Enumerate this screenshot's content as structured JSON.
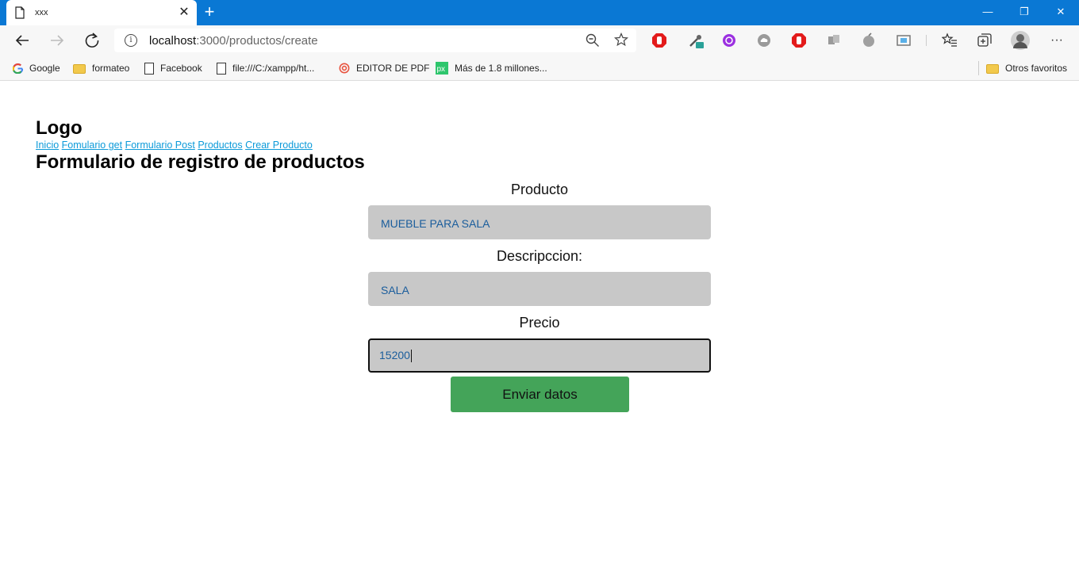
{
  "browser": {
    "tab": {
      "title": "xxx",
      "close": "✕"
    },
    "new_tab": "+",
    "window": {
      "minimize": "—",
      "restore": "❐",
      "close": "✕"
    },
    "address": {
      "host": "localhost",
      "path": ":3000/productos/create"
    },
    "more": "···",
    "bookmarks": [
      {
        "label": "Google",
        "icon": "google-icon"
      },
      {
        "label": "formateo",
        "icon": "folder-icon"
      },
      {
        "label": "Facebook",
        "icon": "page-icon"
      },
      {
        "label": "file:///C:/xampp/ht...",
        "icon": "page-icon"
      },
      {
        "label": "EDITOR DE PDF",
        "icon": "pdf-editor-icon"
      },
      {
        "label": "Más de 1.8 millones...",
        "icon": "px-icon"
      }
    ],
    "other_bookmarks": "Otros favoritos"
  },
  "page": {
    "logo": "Logo",
    "nav": [
      "Inicio",
      "Fomulario get",
      "Formulario Post",
      "Productos",
      "Crear Producto"
    ],
    "title": "Formulario de registro de productos",
    "form": {
      "product_label": "Producto",
      "product_value": "MUEBLE PARA SALA",
      "description_label": "Descripccion:",
      "description_value": "SALA",
      "price_label": "Precio",
      "price_value": "15200",
      "submit": "Enviar datos"
    }
  },
  "colors": {
    "titlebar": "#0a78d4",
    "link": "#0b9ad9",
    "input_bg": "#c8c8c8",
    "input_text": "#1a5d9c",
    "submit_bg": "#44a459"
  }
}
